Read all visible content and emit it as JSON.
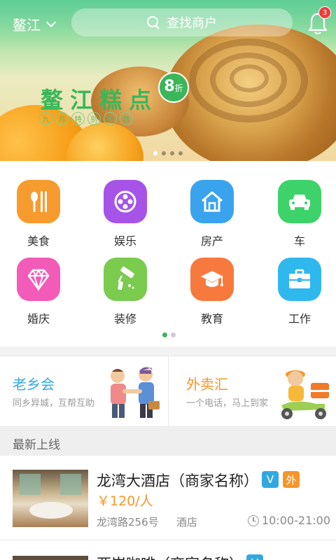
{
  "header": {
    "city": "鳌江",
    "search_placeholder": "查找商户",
    "notification_count": "3"
  },
  "banner": {
    "title": "鳌江糕点",
    "subtitle_chars": [
      "九",
      "月",
      "特",
      "别",
      "推",
      "荐"
    ],
    "discount_number": "8",
    "discount_unit": "折",
    "slide_count": 4,
    "active_slide": 1
  },
  "categories": [
    {
      "label": "美食",
      "icon": "fork-knife-icon",
      "color": "#f79b2e"
    },
    {
      "label": "娱乐",
      "icon": "film-reel-icon",
      "color": "#a653e8"
    },
    {
      "label": "房产",
      "icon": "house-icon",
      "color": "#3aa3ee"
    },
    {
      "label": "车",
      "icon": "car-icon",
      "color": "#3dd36a"
    },
    {
      "label": "婚庆",
      "icon": "diamond-icon",
      "color": "#f25bb8"
    },
    {
      "label": "装修",
      "icon": "paint-roller-icon",
      "color": "#7bcb4e"
    },
    {
      "label": "教育",
      "icon": "graduation-cap-icon",
      "color": "#f7793e"
    },
    {
      "label": "工作",
      "icon": "toolbox-icon",
      "color": "#2fb8ee"
    }
  ],
  "category_pages": {
    "count": 2,
    "active": 1
  },
  "promos": [
    {
      "title": "老乡会",
      "desc": "同乡异城，互帮互助",
      "illustration": "handshake-illustration"
    },
    {
      "title": "外卖汇",
      "desc": "一个电话，马上到家",
      "illustration": "delivery-scooter-illustration"
    }
  ],
  "section": {
    "title": "最新上线"
  },
  "listings": [
    {
      "name": "龙湾大酒店（商家名称）",
      "badges": [
        "V",
        "外"
      ],
      "price": "￥120/人",
      "address": "龙湾路256号",
      "category": "酒店",
      "hours": "10:00-21:00"
    },
    {
      "name": "两岸咖啡（商家名称）",
      "badges": [
        "V"
      ]
    }
  ],
  "colors": {
    "brand_green": "#3bb65a",
    "accent_orange": "#f5962a",
    "accent_blue": "#36a8e0"
  }
}
